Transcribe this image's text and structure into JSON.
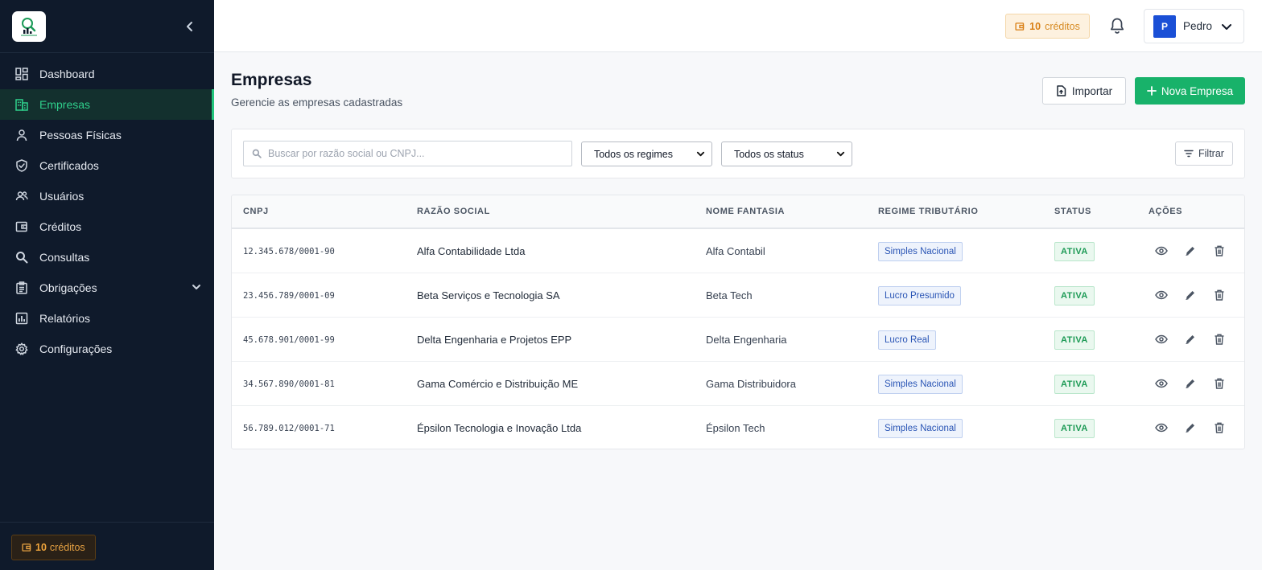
{
  "sidebar": {
    "items": [
      {
        "label": "Dashboard",
        "icon": "dashboard-icon"
      },
      {
        "label": "Empresas",
        "icon": "building-icon",
        "active": true
      },
      {
        "label": "Pessoas Físicas",
        "icon": "person-icon"
      },
      {
        "label": "Certificados",
        "icon": "shield-check-icon"
      },
      {
        "label": "Usuários",
        "icon": "users-icon"
      },
      {
        "label": "Créditos",
        "icon": "wallet-icon"
      },
      {
        "label": "Consultas",
        "icon": "search-icon"
      },
      {
        "label": "Obrigações",
        "icon": "clipboard-icon",
        "expandable": true
      },
      {
        "label": "Relatórios",
        "icon": "report-icon"
      },
      {
        "label": "Configurações",
        "icon": "gear-icon"
      }
    ],
    "credits": {
      "value": "10",
      "label": "créditos"
    }
  },
  "topbar": {
    "credits": {
      "value": "10",
      "label": "créditos"
    },
    "user": {
      "initial": "P",
      "name": "Pedro"
    }
  },
  "page": {
    "title": "Empresas",
    "subtitle": "Gerencie as empresas cadastradas",
    "import_label": "Importar",
    "new_label": "Nova Empresa"
  },
  "filters": {
    "search_placeholder": "Buscar por razão social ou CNPJ...",
    "regime_selected": "Todos os regimes",
    "status_selected": "Todos os status",
    "filter_label": "Filtrar"
  },
  "table": {
    "headers": [
      "CNPJ",
      "RAZÃO SOCIAL",
      "NOME FANTASIA",
      "REGIME TRIBUTÁRIO",
      "STATUS",
      "AÇÕES"
    ],
    "rows": [
      {
        "cnpj": "12.345.678/0001-90",
        "razao": "Alfa Contabilidade Ltda",
        "fantasia": "Alfa Contabil",
        "regime": "Simples Nacional",
        "status": "ATIVA"
      },
      {
        "cnpj": "23.456.789/0001-09",
        "razao": "Beta Serviços e Tecnologia SA",
        "fantasia": "Beta Tech",
        "regime": "Lucro Presumido",
        "status": "ATIVA"
      },
      {
        "cnpj": "45.678.901/0001-99",
        "razao": "Delta Engenharia e Projetos EPP",
        "fantasia": "Delta Engenharia",
        "regime": "Lucro Real",
        "status": "ATIVA"
      },
      {
        "cnpj": "34.567.890/0001-81",
        "razao": "Gama Comércio e Distribuição ME",
        "fantasia": "Gama Distribuidora",
        "regime": "Simples Nacional",
        "status": "ATIVA"
      },
      {
        "cnpj": "56.789.012/0001-71",
        "razao": "Épsilon Tecnologia e Inovação Ltda",
        "fantasia": "Épsilon Tech",
        "regime": "Simples Nacional",
        "status": "ATIVA"
      }
    ]
  },
  "colors": {
    "sidebar_bg": "#0f1a2b",
    "accent_green": "#18b26a",
    "credit_orange": "#d97f15",
    "avatar_blue": "#1a4fd6"
  }
}
